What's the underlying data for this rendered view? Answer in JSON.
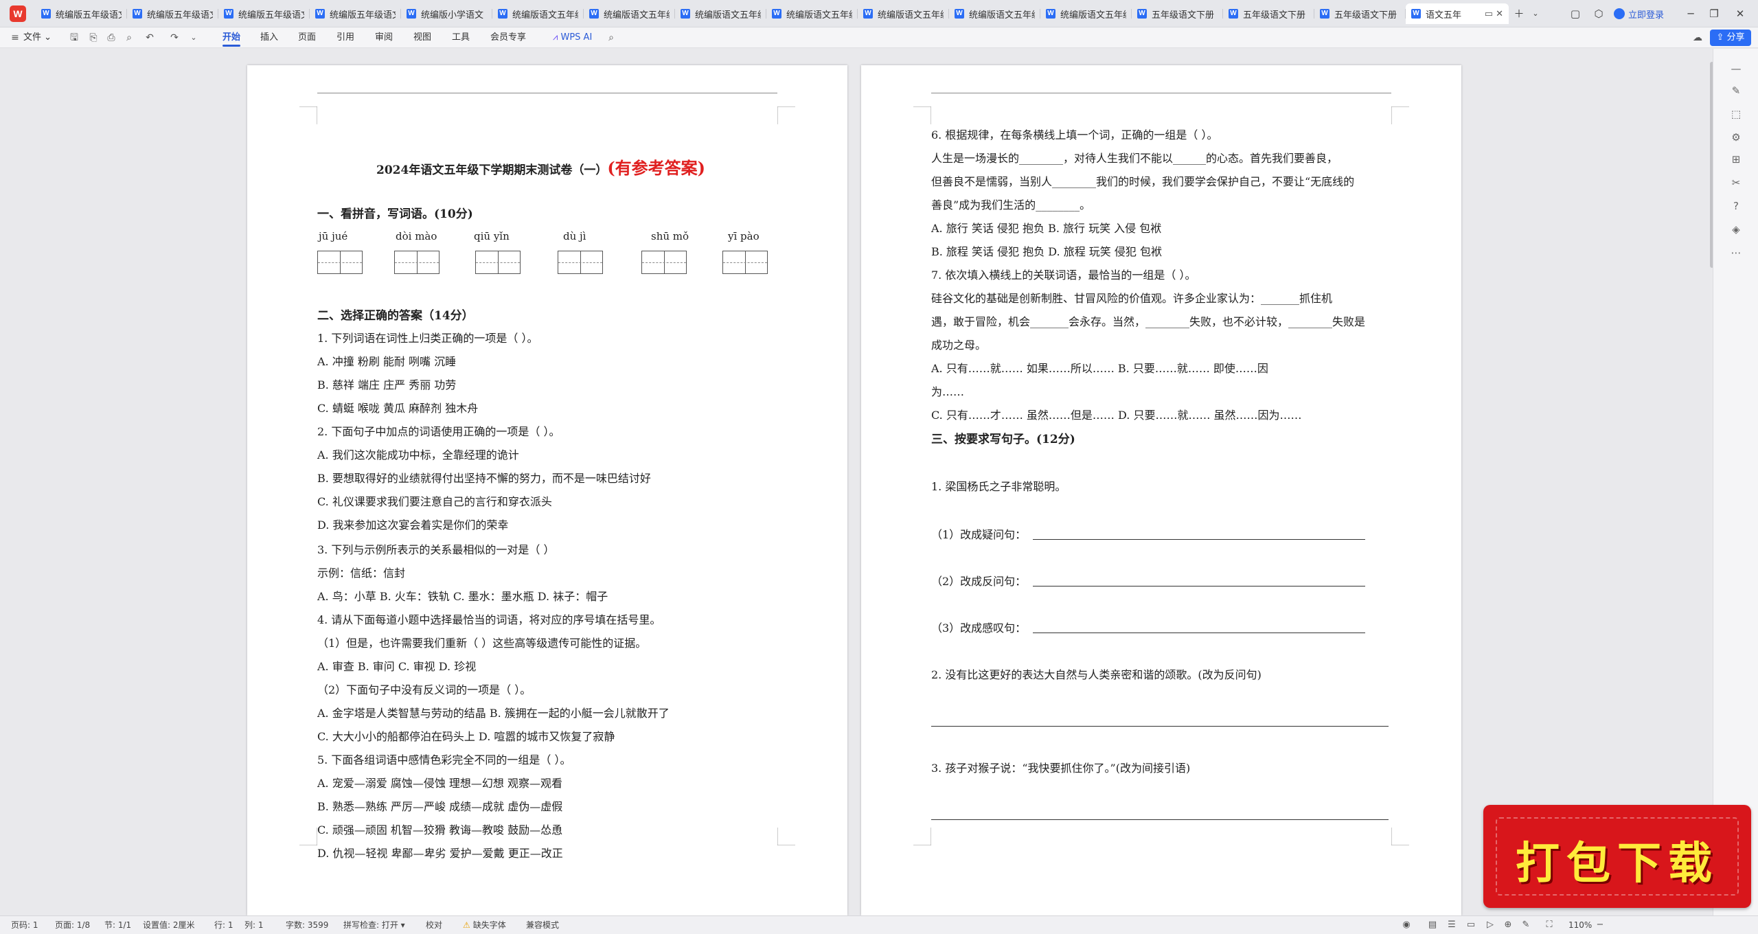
{
  "tabs": [
    {
      "label": "统编版五年级语文"
    },
    {
      "label": "统编版五年级语文"
    },
    {
      "label": "统编版五年级语文"
    },
    {
      "label": "统编版五年级语文"
    },
    {
      "label": "统编版小学语文"
    },
    {
      "label": "统编版语文五年级"
    },
    {
      "label": "统编版语文五年级"
    },
    {
      "label": "统编版语文五年级"
    },
    {
      "label": "统编版语文五年级"
    },
    {
      "label": "统编版语文五年级"
    },
    {
      "label": "统编版语文五年级"
    },
    {
      "label": "统编版语文五年级"
    },
    {
      "label": "五年级语文下册"
    },
    {
      "label": "五年级语文下册"
    },
    {
      "label": "五年级语文下册"
    },
    {
      "label": "语文五年"
    }
  ],
  "titlebar": {
    "login_label": "立即登录"
  },
  "menubar": {
    "file": "文件",
    "items": [
      "开始",
      "插入",
      "页面",
      "引用",
      "审阅",
      "视图",
      "工具",
      "会员专享"
    ],
    "wps_ai": "WPS AI",
    "share": "分享"
  },
  "page1": {
    "title": "2024年语文五年级下学期期末测试卷（一）",
    "answer_tag": "(有参考答案)",
    "sec1": "一、看拼音，写词语。(10分)",
    "pinyin": [
      "jū  jué",
      "dòi mào",
      "qiū  yǐn",
      "dù  jì",
      "shū  mǒ",
      "yī  pào"
    ],
    "sec2": "二、选择正确的答案（14分）",
    "lines": [
      "1. 下列词语在词性上归类正确的一项是（     ）。",
      "A. 冲撞    粉刷    能耐    咧嘴    沉睡",
      "B. 慈祥    端庄    庄严    秀丽    功劳",
      "C. 蜻蜓    喉咙    黄瓜    麻醉剂    独木舟",
      "2. 下面句子中加点的词语使用正确的一项是（     ）。",
      "A. 我们这次能成功中标，全靠经理的诡计",
      "B. 要想取得好的业绩就得付出坚持不懈的努力，而不是一味巴结讨好",
      "C. 礼仪课要求我们要注意自己的言行和穿衣派头",
      "D. 我来参加这次宴会着实是你们的荣幸",
      "3. 下列与示例所表示的关系最相似的一对是（     ）",
      "示例：信纸：信封",
      "A. 鸟：小草        B. 火车：铁轨        C. 墨水：墨水瓶        D. 袜子：帽子",
      "4. 请从下面每道小题中选择最恰当的词语，将对应的序号填在括号里。",
      "（1）但是，也许需要我们重新（     ）这些高等级遗传可能性的证据。",
      "A. 审查                B. 审问                C. 审视                D. 珍视",
      "（2）下面句子中没有反义词的一项是（     ）。",
      "A. 金字塔是人类智慧与劳动的结晶                    B. 簇拥在一起的小艇一会儿就散开了",
      "C. 大大小小的船都停泊在码头上                        D.  喧嚣的城市又恢复了寂静",
      "5. 下面各组词语中感情色彩完全不同的一组是（     ）。",
      "A. 宠爱—溺爱        腐蚀—侵蚀        理想—幻想        观察—观看",
      "B. 熟悉—熟练        严厉—严峻        成绩—成就        虚伪—虚假",
      "C. 顽强—顽固        机智—狡猾        教诲—教唆        鼓励—怂恿",
      "D. 仇视—轻视        卑鄙—卑劣        爱护—爱戴        更正—改正"
    ]
  },
  "page2": {
    "lines": [
      "6. 根据规律，在每条横线上填一个词，正确的一组是（     ）。",
      "        人生是一场漫长的________，对待人生我们不能以______的心态。首先我们要善良，",
      "但善良不是懦弱，当别人________我们的时候，我们要学会保护自己，不要让“无底线的",
      "善良”成为我们生活的________。",
      "A. 旅行        笑话        侵犯        抱负                   B. 旅行        玩笑        入侵        包袱",
      "B. 旅程        笑话        侵犯        抱负                   D. 旅程        玩笑        侵犯        包袱",
      "7. 依次填入横线上的关联词语，最恰当的一组是（     ）。",
      "        硅谷文化的基础是创新制胜、甘冒风险的价值观。许多企业家认为：_______抓住机",
      "遇，敢于冒险，机会_______会永存。当然，________失败，也不必计较，________失败是",
      "成功之母。",
      "A.  只有……就……        如果……所以……        B.  只要……就……            即使……因",
      "为……",
      "C.  只有……才……        虽然……但是……        D. 只要……就……            虽然……因为……",
      "三、按要求写句子。(12分)",
      "1. 梁国杨氏之子非常聪明。",
      "（1）改成疑问句：",
      "（2）改成反问句：",
      "（3）改成感叹句：",
      "2. 没有比这更好的表达大自然与人类亲密和谐的颂歌。(改为反问句)",
      "3. 孩子对猴子说：“我快要抓住你了。”(改为间接引语)"
    ]
  },
  "status": {
    "page_no": "页码: 1",
    "pages": "页面: 1/8",
    "section": "节: 1/1",
    "setting": "设置值: 2厘米",
    "row": "行: 1",
    "col": "列: 1",
    "words": "字数: 3599",
    "spell": "拼写检查: 打开 ▾",
    "proof": "校对",
    "missing_font": "缺失字体",
    "compat": "兼容模式",
    "zoom": "110%"
  },
  "banner": {
    "text": "打包下载"
  },
  "colors": {
    "accent": "#2b5bd7",
    "answer_red": "#e02020",
    "banner_red": "#d8161b",
    "banner_text": "#ffeb3b"
  }
}
